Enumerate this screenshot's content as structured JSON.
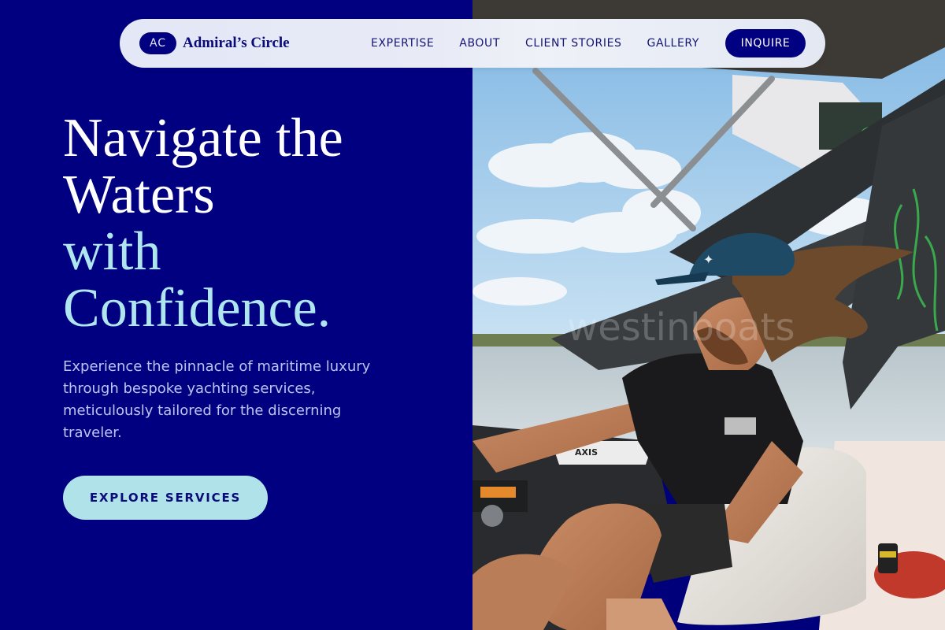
{
  "nav": {
    "brand_initials": "AC",
    "brand_name": "Admiral’s Circle",
    "links": [
      "EXPERTISE",
      "ABOUT",
      "CLIENT STORIES",
      "GALLERY"
    ],
    "cta": "INQUIRE"
  },
  "hero": {
    "headline_line1": "Navigate the",
    "headline_line2": "Waters",
    "headline_line3": "with",
    "headline_line4": "Confidence.",
    "subcopy": "Experience the pinnacle of maritime luxury through bespoke yachting services, meticulously tailored for the discerning traveler.",
    "cta": "EXPLORE SERVICES"
  },
  "photo": {
    "watermark": "westinboats",
    "boat_brand": "AXIS"
  },
  "colors": {
    "navy": "#000080",
    "accent_light_blue": "#aee5ee",
    "cta_bg": "#b0e2ea",
    "subcopy": "#bcc5f0"
  }
}
